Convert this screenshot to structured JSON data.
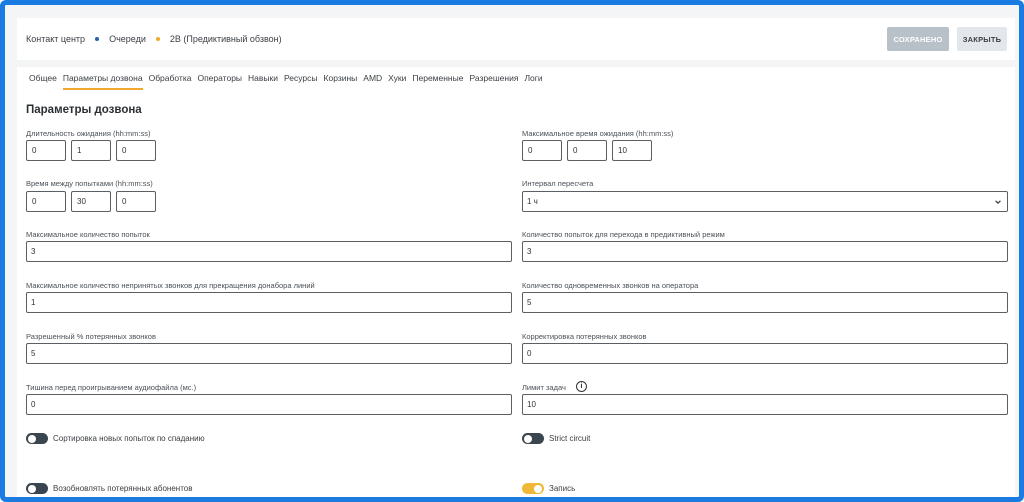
{
  "breadcrumb": {
    "items": [
      "Контакт центр",
      "Очереди",
      "2В (Предиктивный обзвон)"
    ],
    "dot_colors": [
      "#2a5fa8",
      "#f0a82c"
    ]
  },
  "header": {
    "saved_label": "Сохранено",
    "close_label": "Закрыть"
  },
  "tabs": [
    {
      "label": "Общее",
      "active": false
    },
    {
      "label": "Параметры дозвона",
      "active": true
    },
    {
      "label": "Обработка",
      "active": false
    },
    {
      "label": "Операторы",
      "active": false
    },
    {
      "label": "Навыки",
      "active": false
    },
    {
      "label": "Ресурсы",
      "active": false
    },
    {
      "label": "Корзины",
      "active": false
    },
    {
      "label": "AMD",
      "active": false
    },
    {
      "label": "Хуки",
      "active": false
    },
    {
      "label": "Переменные",
      "active": false
    },
    {
      "label": "Разрешения",
      "active": false
    },
    {
      "label": "Логи",
      "active": false
    }
  ],
  "page_title": "Параметры дозвона",
  "fields": {
    "wait_duration": {
      "label": "Длительность ожидания (hh:mm:ss)",
      "h": "0",
      "m": "1",
      "s": "0"
    },
    "max_wait": {
      "label": "Максимальное время ожидания (hh:mm:ss)",
      "h": "0",
      "m": "0",
      "s": "10"
    },
    "retry_interval": {
      "label": "Время между попытками (hh:mm:ss)",
      "h": "0",
      "m": "30",
      "s": "0"
    },
    "recalc_interval": {
      "label": "Интервал пересчета",
      "value": "1 ч"
    },
    "max_attempts": {
      "label": "Максимальное количество попыток",
      "value": "3"
    },
    "predictive_attempts": {
      "label": "Количество попыток для перехода в предиктивный режим",
      "value": "3"
    },
    "max_unanswered": {
      "label": "Максимальное количество непринятых звонков для прекращения донабора линий",
      "value": "1"
    },
    "concurrent_calls": {
      "label": "Количество одновременных звонков на оператора",
      "value": "5"
    },
    "lost_percent": {
      "label": "Разрешенный % потерянных звонков",
      "value": "5"
    },
    "lost_correction": {
      "label": "Корректировка потерянных звонков",
      "value": "0"
    },
    "silence_before_audio": {
      "label": "Тишина перед проигрыванием аудиофайла (мс.)",
      "value": "0"
    },
    "task_limit": {
      "label": "Лимит задач",
      "value": "10"
    }
  },
  "toggles": {
    "sort_desc": {
      "label": "Сортировка новых попыток по спаданию",
      "on": false
    },
    "strict_circuit": {
      "label": "Strict circuit",
      "on": false
    },
    "resume_lost": {
      "label": "Возобновлять потерянных абонентов",
      "on": false
    },
    "record": {
      "label": "Запись",
      "on": true
    }
  },
  "icons": {
    "info": "info-icon",
    "chevron": "chevron-down-icon"
  },
  "colors": {
    "accent": "#f0a82c",
    "frame": "#1a7be0"
  }
}
